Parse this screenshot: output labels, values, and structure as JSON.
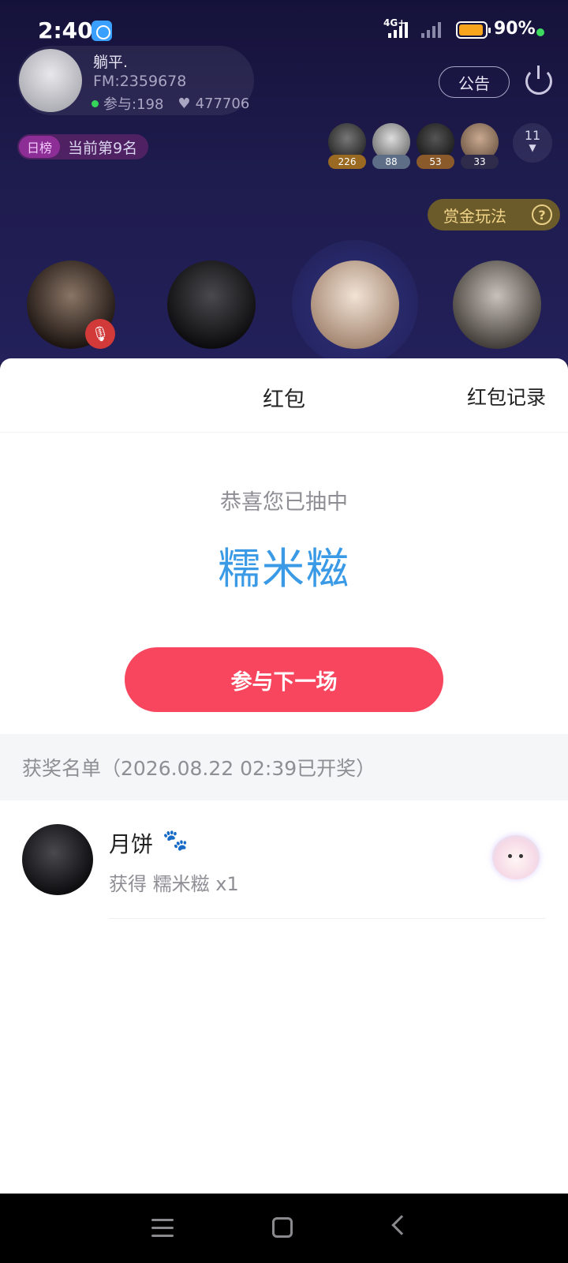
{
  "status_bar": {
    "time": "2:40",
    "network": "4G+",
    "battery": "90%"
  },
  "room": {
    "host_name": "躺平.",
    "fm_id": "FM:2359678",
    "participants": "参与:198",
    "likes": "477706",
    "notice_label": "公告",
    "rank_tag": "日榜",
    "rank_text": "当前第9名",
    "viewers": [
      {
        "count": "226",
        "badge_color": "#9a6a22"
      },
      {
        "count": "88",
        "badge_color": "#5d6e86"
      },
      {
        "count": "53",
        "badge_color": "#8a5a2a"
      },
      {
        "count": "33",
        "badge_color": "#2f2b4a"
      }
    ],
    "more_viewers": "11",
    "bounty_label": "赏金玩法"
  },
  "sheet": {
    "title": "红包",
    "records_link": "红包记录",
    "congrats": "恭喜您已抽中",
    "prize_name": "糯米糍",
    "next_button": "参与下一场",
    "winners_title": "获奖名单（2026.08.22 02:39已开奖）",
    "winners": [
      {
        "name": "月饼",
        "prize": "获得 糯米糍 x1"
      }
    ]
  },
  "colors": {
    "accent_blue": "#3a9ae6",
    "button_red": "#f8465f",
    "room_bg": "#1e1b4d"
  }
}
